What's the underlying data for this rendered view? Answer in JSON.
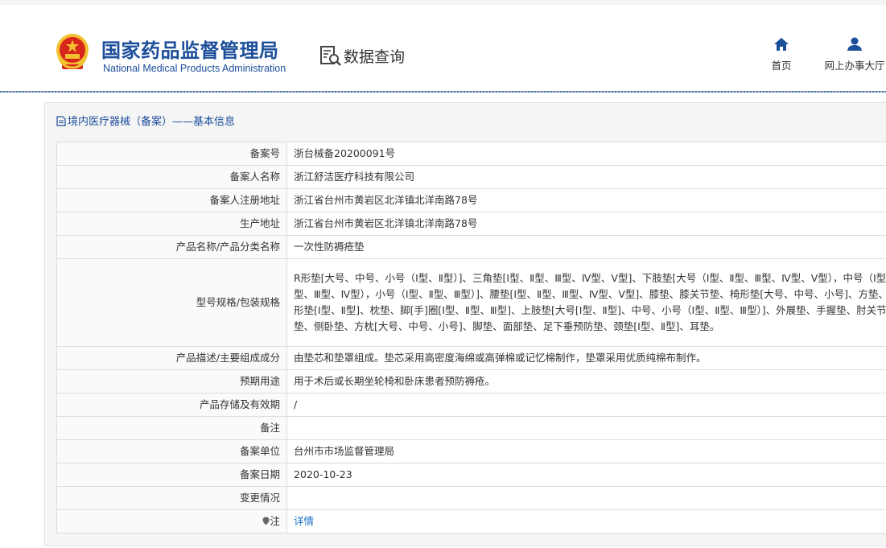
{
  "header": {
    "org_name_cn": "国家药品监督管理局",
    "org_name_en": "National Medical Products Administration",
    "section_label": "数据查询",
    "nav": [
      {
        "label": "首页",
        "icon": "home-icon"
      },
      {
        "label": "网上办事大厅",
        "icon": "user-icon"
      }
    ]
  },
  "panel": {
    "title": "境内医疗器械（备案）——基本信息",
    "title_icon": "document-icon"
  },
  "rows": [
    {
      "label": "备案号",
      "value": "浙台械备20200091号"
    },
    {
      "label": "备案人名称",
      "value": "浙江舒洁医疗科技有限公司"
    },
    {
      "label": "备案人注册地址",
      "value": "浙江省台州市黄岩区北洋镇北洋南路78号"
    },
    {
      "label": "生产地址",
      "value": "浙江省台州市黄岩区北洋镇北洋南路78号"
    },
    {
      "label": "产品名称/产品分类名称",
      "value": "一次性防褥疮垫"
    },
    {
      "label": "型号规格/包装规格",
      "value": "R形垫[大号、中号、小号（Ⅰ型、Ⅱ型）]、三角垫[Ⅰ型、Ⅱ型、Ⅲ型、Ⅳ型、Ⅴ型]、下肢垫[大号（Ⅰ型、Ⅱ型、Ⅲ型、Ⅳ型、Ⅴ型），中号（Ⅰ型、Ⅱ型、Ⅲ型、Ⅳ型），小号（Ⅰ型、Ⅱ型、Ⅲ型）]、腰垫[Ⅰ型、Ⅱ型、Ⅲ型、Ⅳ型、Ⅴ型]、膝垫、膝关节垫、椅形垫[大号、中号、小号]、方垫、U形垫[Ⅰ型、Ⅱ型]、枕垫、脚[手]圈[Ⅰ型、Ⅱ型、Ⅲ型]、上肢垫[大号[Ⅰ型、Ⅱ型]、中号、小号（Ⅰ型、Ⅱ型、Ⅲ型）]、外展垫、手握垫、肘关节垫、侧卧垫、方枕[大号、中号、小号]、脚垫、面部垫、足下垂预防垫、颈垫[Ⅰ型、Ⅱ型]、耳垫。"
    },
    {
      "label": "产品描述/主要组成成分",
      "value": "由垫芯和垫罩组成。垫芯采用高密度海绵或高弹棉或记忆棉制作，垫罩采用优质纯棉布制作。"
    },
    {
      "label": "预期用途",
      "value": "用于术后或长期坐轮椅和卧床患者预防褥疮。"
    },
    {
      "label": "产品存储及有效期",
      "value": "/"
    },
    {
      "label": "备注",
      "value": ""
    },
    {
      "label": "备案单位",
      "value": "台州市市场监督管理局"
    },
    {
      "label": "备案日期",
      "value": "2020-10-23"
    },
    {
      "label": "变更情况",
      "value": ""
    },
    {
      "label": "注",
      "value": "详情",
      "label_icon": "pin-icon"
    }
  ],
  "colors": {
    "brand_blue": "#1c4e9a",
    "link_blue": "#1c6fc4",
    "emblem_red": "#d8261c",
    "emblem_gold": "#f3c12f"
  }
}
